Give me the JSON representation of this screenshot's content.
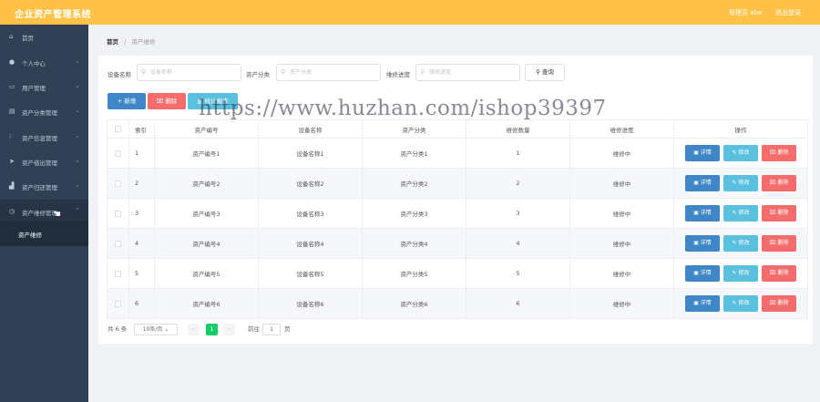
{
  "app": {
    "title": "企业资产管理系统",
    "admin_label": "管理员 abo",
    "logout_label": "退出登录"
  },
  "sidebar": {
    "items": [
      {
        "label": "首页",
        "icon": "home-icon"
      },
      {
        "label": "个人中心",
        "icon": "user-icon"
      },
      {
        "label": "用户管理",
        "icon": "users-icon"
      },
      {
        "label": "资产分类管理",
        "icon": "category-icon"
      },
      {
        "label": "资产信息管理",
        "icon": "info-icon"
      },
      {
        "label": "资产借出管理",
        "icon": "send-icon"
      },
      {
        "label": "资产归还管理",
        "icon": "return-icon"
      },
      {
        "label": "资产维修管理",
        "icon": "repair-icon"
      }
    ],
    "sub_item": "资产维修"
  },
  "breadcrumb": {
    "home": "首页",
    "sep": "/",
    "current": "资产维修"
  },
  "filters": {
    "name_label": "设备名称",
    "name_placeholder": "设备名称",
    "category_label": "资产分类",
    "category_placeholder": "资产分类",
    "progress_label": "维修进度",
    "progress_placeholder": "维修进度",
    "query_label": "查询"
  },
  "toolbar": {
    "add_label": "新增",
    "delete_label": "删除",
    "report_label": "统计报表"
  },
  "table": {
    "headers": [
      "索引",
      "资产编号",
      "设备名称",
      "资产分类",
      "维修数量",
      "维修进度",
      "操作"
    ],
    "rows": [
      {
        "index": "1",
        "code": "资产编号1",
        "name": "设备名称1",
        "category": "资产分类1",
        "qty": "1",
        "progress": "维修中"
      },
      {
        "index": "2",
        "code": "资产编号2",
        "name": "设备名称2",
        "category": "资产分类2",
        "qty": "2",
        "progress": "维修中"
      },
      {
        "index": "3",
        "code": "资产编号3",
        "name": "设备名称3",
        "category": "资产分类3",
        "qty": "3",
        "progress": "维修中"
      },
      {
        "index": "4",
        "code": "资产编号4",
        "name": "设备名称4",
        "category": "资产分类4",
        "qty": "4",
        "progress": "维修中"
      },
      {
        "index": "5",
        "code": "资产编号5",
        "name": "设备名称5",
        "category": "资产分类5",
        "qty": "5",
        "progress": "维修中"
      },
      {
        "index": "6",
        "code": "资产编号6",
        "name": "设备名称6",
        "category": "资产分类6",
        "qty": "6",
        "progress": "维修中"
      }
    ],
    "actions": {
      "detail": "详情",
      "edit": "修改",
      "delete": "删除"
    }
  },
  "pagination": {
    "total": "共 6 条",
    "page_size": "10条/页",
    "current_page": "1",
    "goto_label": "前往",
    "goto_value": "1",
    "page_unit": "页"
  },
  "watermark": "https://www.huzhan.com/ishop39397",
  "colors": {
    "topbar": "#ffc247",
    "sidebar": "#304156",
    "primary": "#3f86c6",
    "danger": "#f56c6c",
    "info": "#5bc0de",
    "success": "#13ce66"
  }
}
